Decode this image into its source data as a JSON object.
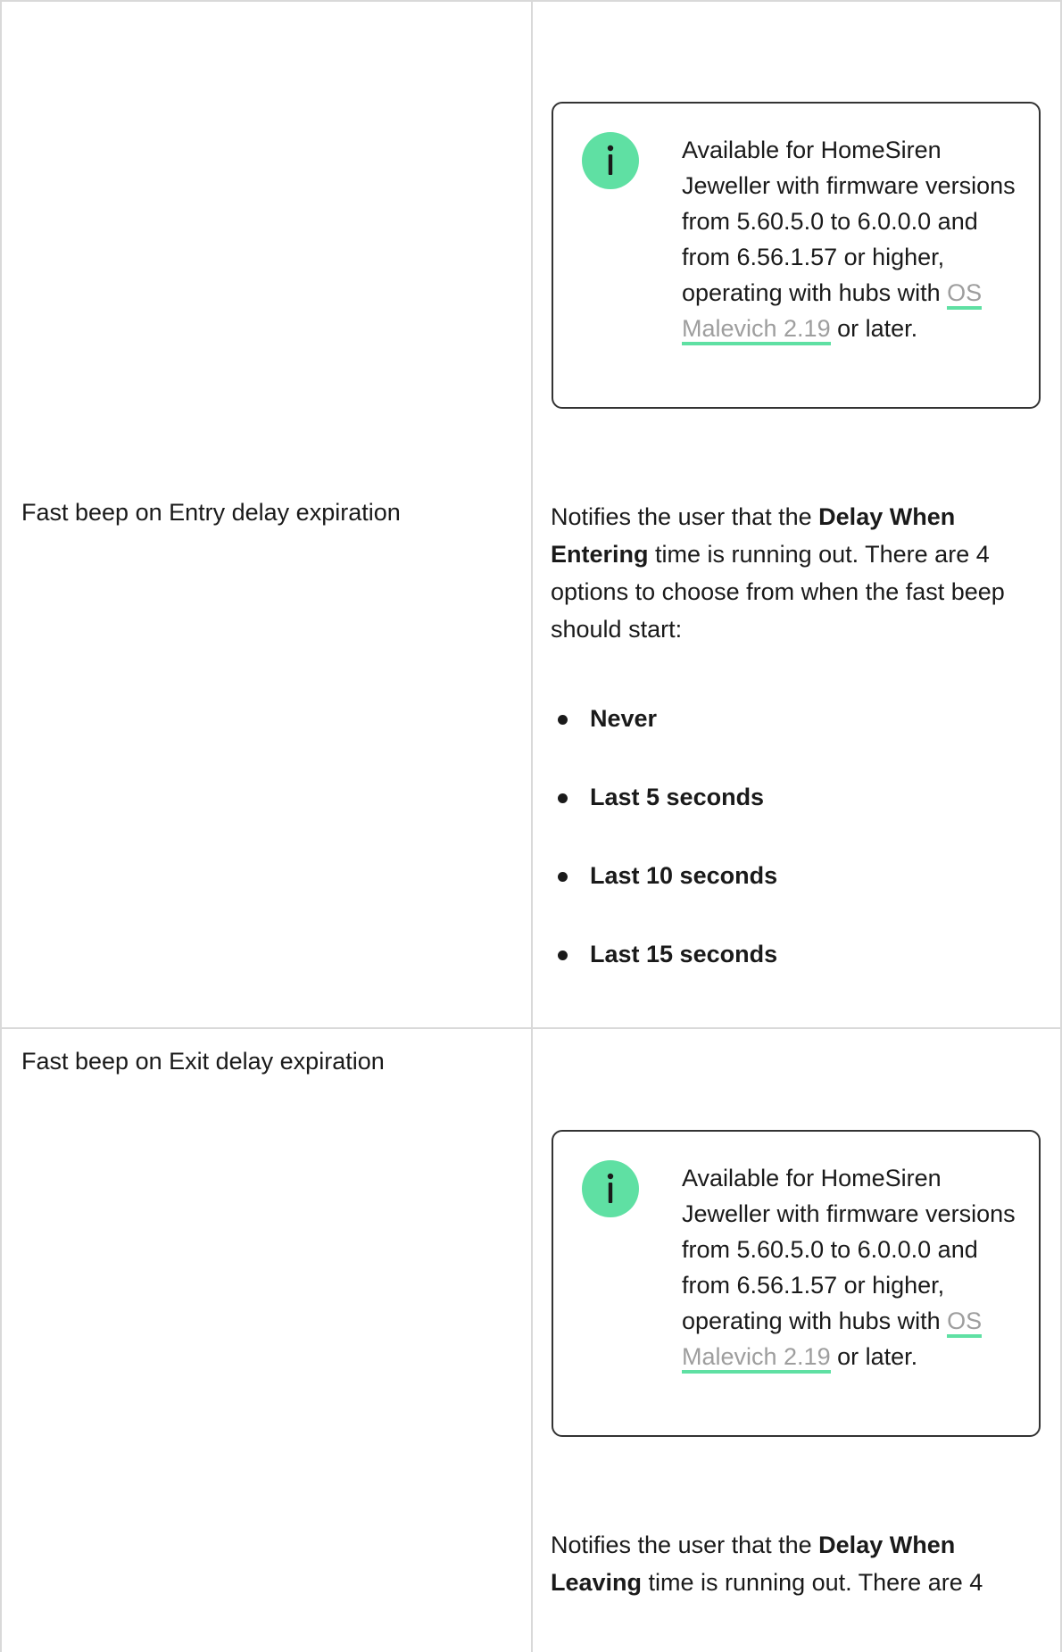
{
  "rows": [
    {
      "label": "",
      "note": {
        "icon": "info-icon",
        "text_before": "Available for HomeSiren Jeweller with firmware versions from 5.60.5.0 to 6.0.0.0 and from 6.56.1.57 or higher, operating with hubs with ",
        "link_text": "OS Malevich 2.19",
        "text_after": " or later."
      }
    },
    {
      "label": "Fast beep on Entry delay expiration",
      "description": {
        "before": "Notifies the user that the ",
        "bold": "Delay When Entering",
        "after": " time is running out. There are 4 options to choose from when the fast beep should start:"
      },
      "options": [
        "Never",
        "Last 5 seconds",
        "Last 10 seconds",
        "Last 15 seconds"
      ]
    },
    {
      "label": "Fast beep on Exit delay expiration",
      "note": {
        "icon": "info-icon",
        "text_before": "Available for HomeSiren Jeweller with firmware versions from 5.60.5.0 to 6.0.0.0 and from 6.56.1.57 or higher, operating with hubs with ",
        "link_text": "OS Malevich 2.19",
        "text_after": " or later."
      },
      "description": {
        "before": "Notifies the user that the ",
        "bold": "Delay When Leaving",
        "after": " time is running out. There are 4"
      }
    }
  ],
  "colors": {
    "accent": "#5fe0a3",
    "link": "#9e9e9e",
    "border": "#d9d9d9",
    "text": "#1a1a1a"
  }
}
